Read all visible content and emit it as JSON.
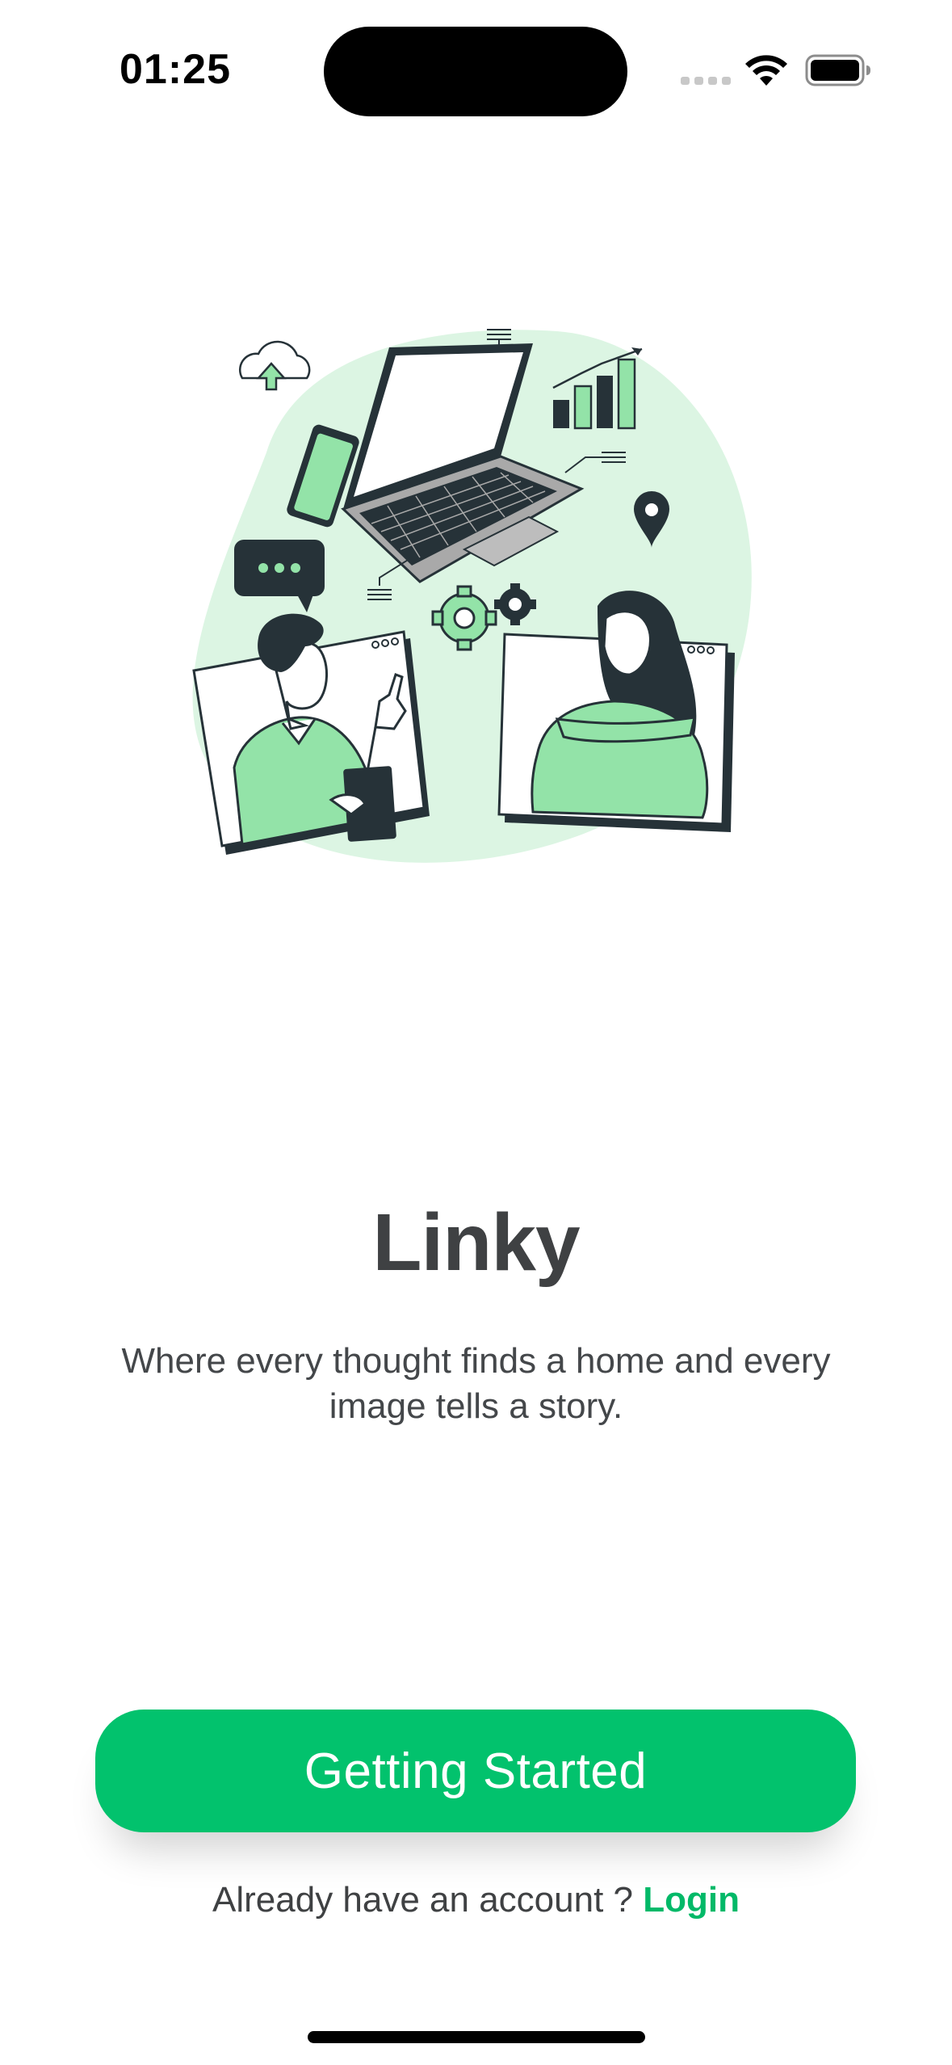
{
  "status_bar": {
    "time": "01:25"
  },
  "hero": {
    "illustration": "remote-communication-illustration",
    "accent_color": "#93e3a8",
    "blob_color": "#dcf5e3",
    "outline_color": "#263238"
  },
  "main": {
    "title": "Linky",
    "tagline": "Where every thought finds a home and every image tells a story."
  },
  "actions": {
    "primary_button_label": "Getting Started",
    "primary_color": "#02c26d",
    "login_prompt": "Already have an account ? ",
    "login_link_label": "Login"
  }
}
